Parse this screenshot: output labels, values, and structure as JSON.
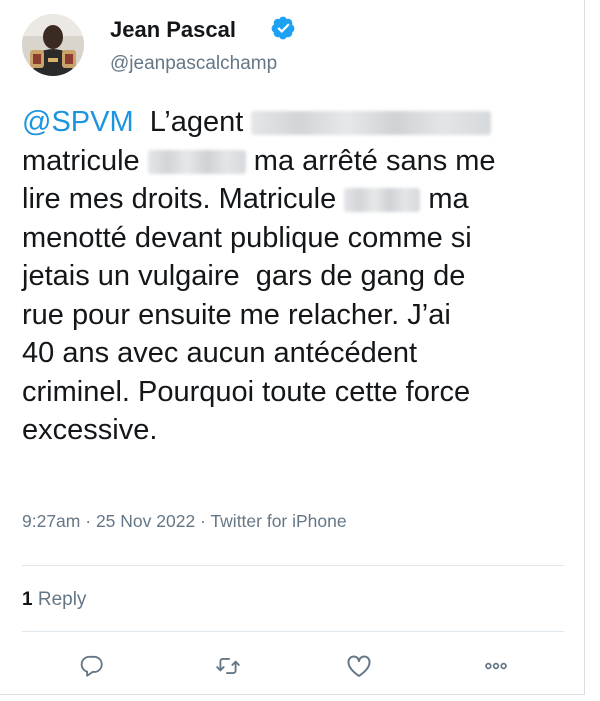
{
  "user": {
    "name": "Jean Pascal",
    "handle": "@jeanpascalchamp",
    "verified": true
  },
  "tweet": {
    "mention": "@SPVM",
    "line1_text": "L’agent",
    "line2_a": "matricule",
    "line2_b": "ma arrêté sans me",
    "line3_a": "lire mes droits. Matricule",
    "line3_b": "ma",
    "line4": "menotté devant publique comme si",
    "line5": "jetais un vulgaire  gars de gang de",
    "line6": "rue pour ensuite me relacher. J’ai",
    "line7": "40 ans avec aucun antécédent",
    "line8": "criminel. Pourquoi toute cette force",
    "line9": "excessive."
  },
  "meta": {
    "time": "9:27am",
    "sep1": " · ",
    "date": "25 Nov 2022",
    "sep2": " · ",
    "source": "Twitter for iPhone"
  },
  "stats": {
    "reply_count": "1",
    "reply_label": " Reply"
  },
  "actions": [
    {
      "icon": "reply-icon"
    },
    {
      "icon": "retweet-icon"
    },
    {
      "icon": "like-icon"
    },
    {
      "icon": "more-icon"
    }
  ],
  "colors": {
    "link": "#1b95e0",
    "verified": "#1da1f2",
    "muted": "#657786",
    "text": "#14171a"
  }
}
